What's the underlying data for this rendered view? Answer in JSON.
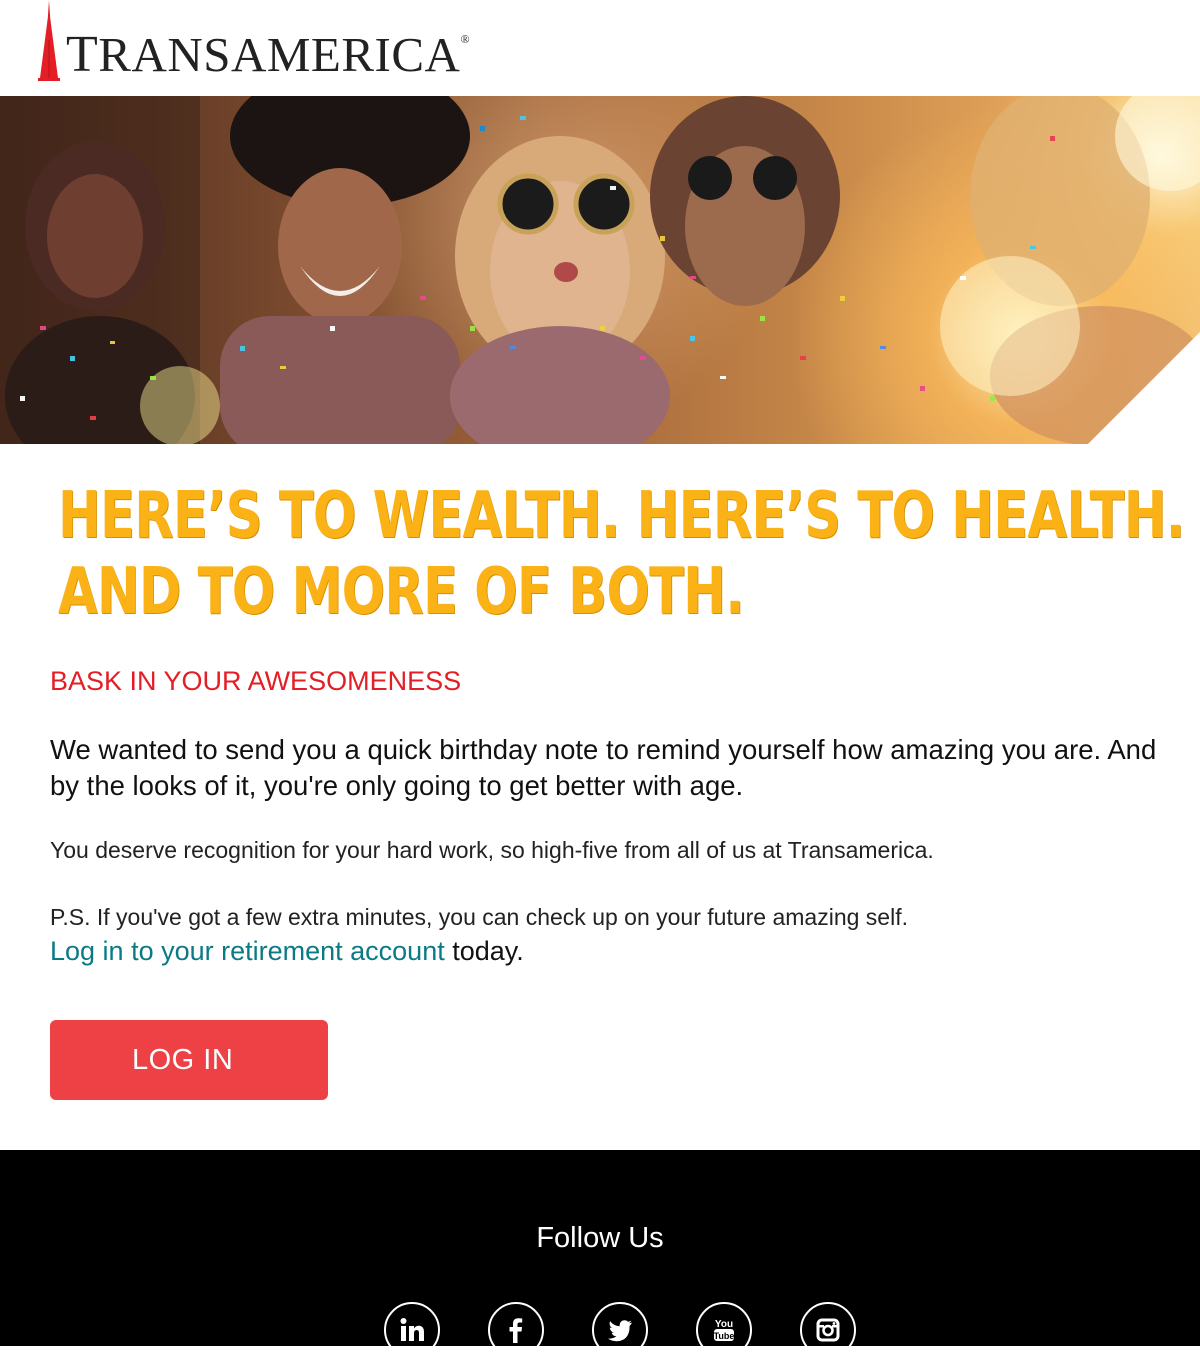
{
  "brand": {
    "logo_text": "TRANSAMERICA",
    "logo_first_letter": "T",
    "logo_rest": "RANSAMERICA",
    "registered_mark": "®",
    "brand_red": "#e31e24"
  },
  "hero": {
    "image": "friends-celebrating-confetti-image"
  },
  "headline": {
    "line1": "HERE’S TO WEALTH. HERE’S TO HEALTH.",
    "line2": "AND TO MORE OF BOTH.",
    "color": "#fbb217"
  },
  "subhead": "BASK IN YOUR AWESOMENESS",
  "body": {
    "lead": "We wanted to send you a quick birthday note to remind yourself how amazing you are. And by the looks of it, you're only going to get better with age.",
    "para": "You deserve recognition for your hard work, so high-five from all of us at Transamerica.",
    "ps": "P.S. If you've got a few extra minutes, you can check up on your future amazing self.",
    "link_text": "Log in to your retirement account",
    "link_suffix": " today.",
    "link_color": "#0b7a85"
  },
  "cta": {
    "label": "LOG IN",
    "color": "#ee4146"
  },
  "footer": {
    "follow_label": "Follow Us",
    "social": [
      {
        "name": "linkedin-icon"
      },
      {
        "name": "facebook-icon"
      },
      {
        "name": "twitter-icon"
      },
      {
        "name": "youtube-icon",
        "text": "You Tube"
      },
      {
        "name": "instagram-icon"
      }
    ]
  }
}
